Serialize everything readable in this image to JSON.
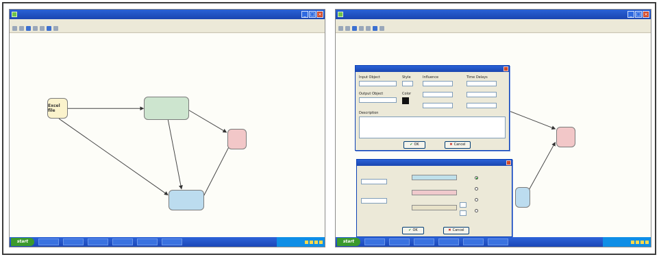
{
  "colors": {
    "node_excel": "#fbf3cc",
    "node_green": "#cde5cf",
    "node_red": "#f2c7c8",
    "node_blue": "#bcdcef",
    "label_highlight": "#f3ea7a",
    "titlebar": "#2a62d6",
    "taskbar": "#1b47b8"
  },
  "left_window": {
    "title": "",
    "menu": [
      "",
      "",
      "",
      ""
    ],
    "nodes": {
      "excel": "Excel file",
      "green": "",
      "red": "",
      "blue": ""
    },
    "edge_labels": [
      {
        "top": "",
        "value": ""
      },
      {
        "top": "",
        "value": ""
      },
      {
        "top": "",
        "value": ""
      },
      {
        "top": "",
        "value": ""
      },
      {
        "top": "",
        "value": ""
      }
    ],
    "taskbar": {
      "start": "start",
      "items": [
        "",
        "",
        "",
        "",
        "",
        ""
      ]
    }
  },
  "right_window": {
    "title": "",
    "menu": [
      "",
      "",
      "",
      ""
    ],
    "nodes": {
      "red": "",
      "blue": ""
    },
    "edge_labels": [
      {
        "top": "",
        "value": ""
      },
      {
        "top": "",
        "value": ""
      }
    ],
    "dialog1": {
      "title": "",
      "input_object_label": "Input Object",
      "input_object_value": "",
      "output_object_label": "Output Object",
      "output_object_value": "",
      "color_label": "Color",
      "style_label": "Style",
      "influence_label": "Influence",
      "time_delays_label": "Time Delays",
      "description_label": "Description",
      "description_value": "",
      "ok": "OK",
      "cancel": "Cancel"
    },
    "dialog2": {
      "title": "",
      "initial_value_label": "",
      "initial_value_value": "",
      "range_label": "",
      "range_value": "",
      "slot1_label": "",
      "slot2_label": "",
      "slot3_label": "",
      "options_title": "",
      "options": [
        "",
        "",
        "",
        ""
      ],
      "ok": "OK",
      "cancel": "Cancel"
    },
    "taskbar": {
      "start": "start",
      "items": [
        "",
        "",
        "",
        "",
        "",
        ""
      ]
    }
  }
}
